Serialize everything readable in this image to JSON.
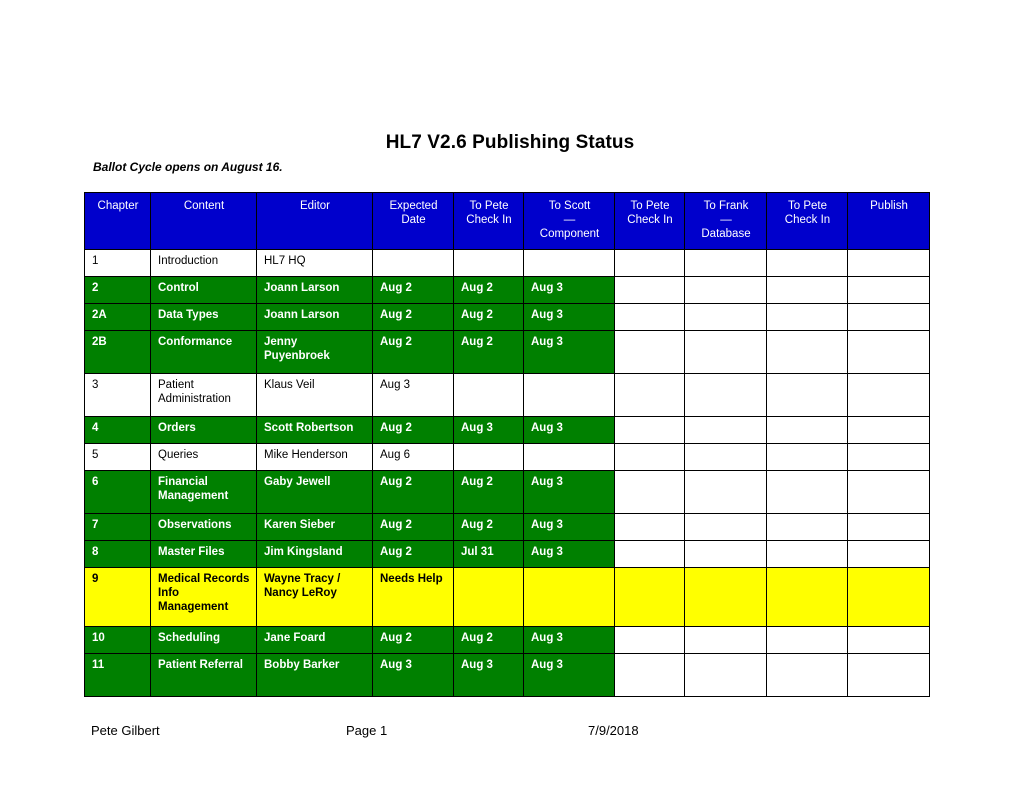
{
  "document": {
    "title": "HL7 V2.6 Publishing Status",
    "subtitle": "Ballot Cycle opens on August 16."
  },
  "colors": {
    "header_background": "#0000CC",
    "header_text": "#FFFFFF",
    "status_green": "#008000",
    "status_yellow": "#FFFF00",
    "status_white": "#FFFFFF",
    "border": "#000000"
  },
  "table": {
    "columns": [
      {
        "key": "chapter",
        "label": "Chapter"
      },
      {
        "key": "content",
        "label": "Content"
      },
      {
        "key": "editor",
        "label": "Editor"
      },
      {
        "key": "expected",
        "label": "Expected Date",
        "line1": "Expected",
        "line2": "Date"
      },
      {
        "key": "topete1",
        "label": "To Pete Check In",
        "line1": "To Pete",
        "line2": "Check In"
      },
      {
        "key": "toscott",
        "label": "To Scott — Component",
        "line1": "To Scott",
        "line2": "—",
        "line3": "Component"
      },
      {
        "key": "topete2",
        "label": "To Pete Check In",
        "line1": "To Pete",
        "line2": "Check In"
      },
      {
        "key": "tofrank",
        "label": "To Frank — Database",
        "line1": "To Frank",
        "line2": "—",
        "line3": "Database"
      },
      {
        "key": "topete3",
        "label": "To Pete Check In",
        "line1": "To Pete",
        "line2": "Check In"
      },
      {
        "key": "publish",
        "label": "Publish"
      }
    ],
    "rows": [
      {
        "state": "white",
        "height": "r-h1",
        "chapter": "1",
        "content": "Introduction",
        "editor": "HL7 HQ",
        "expected": "",
        "topete1": "",
        "toscott": "",
        "topete2": "",
        "tofrank": "",
        "topete3": "",
        "publish": ""
      },
      {
        "state": "green",
        "height": "r-h1",
        "chapter": "2",
        "content": "Control",
        "editor": "Joann Larson",
        "expected": "Aug 2",
        "topete1": "Aug 2",
        "toscott": "Aug 3",
        "topete2": "",
        "tofrank": "",
        "topete3": "",
        "publish": ""
      },
      {
        "state": "green",
        "height": "r-h1",
        "chapter": "2A",
        "content": "Data Types",
        "editor": "Joann Larson",
        "expected": "Aug 2",
        "topete1": "Aug 2",
        "toscott": "Aug 3",
        "topete2": "",
        "tofrank": "",
        "topete3": "",
        "publish": ""
      },
      {
        "state": "green",
        "height": "r-h2",
        "chapter": "2B",
        "content": "Conformance",
        "editor": "Jenny Puyenbroek",
        "expected": "Aug 2",
        "topete1": "Aug 2",
        "toscott": "Aug 3",
        "topete2": "",
        "tofrank": "",
        "topete3": "",
        "publish": ""
      },
      {
        "state": "white",
        "height": "r-h2",
        "chapter": "3",
        "content": "Patient Administration",
        "editor": "Klaus Veil",
        "expected": "Aug 3",
        "topete1": "",
        "toscott": "",
        "topete2": "",
        "tofrank": "",
        "topete3": "",
        "publish": ""
      },
      {
        "state": "green",
        "height": "r-h1",
        "chapter": "4",
        "content": "Orders",
        "editor": "Scott Robertson",
        "expected": "Aug 2",
        "topete1": "Aug 3",
        "toscott": "Aug 3",
        "topete2": "",
        "tofrank": "",
        "topete3": "",
        "publish": ""
      },
      {
        "state": "white",
        "height": "r-h1",
        "chapter": "5",
        "content": "Queries",
        "editor": "Mike Henderson",
        "expected": "Aug 6",
        "topete1": "",
        "toscott": "",
        "topete2": "",
        "tofrank": "",
        "topete3": "",
        "publish": ""
      },
      {
        "state": "green",
        "height": "r-h2",
        "chapter": "6",
        "content": "Financial Management",
        "editor": "Gaby Jewell",
        "expected": "Aug 2",
        "topete1": "Aug 2",
        "toscott": "Aug 3",
        "topete2": "",
        "tofrank": "",
        "topete3": "",
        "publish": ""
      },
      {
        "state": "green",
        "height": "r-h1",
        "chapter": "7",
        "content": "Observations",
        "editor": "Karen Sieber",
        "expected": "Aug 2",
        "topete1": "Aug 2",
        "toscott": "Aug 3",
        "topete2": "",
        "tofrank": "",
        "topete3": "",
        "publish": ""
      },
      {
        "state": "green",
        "height": "r-h1",
        "chapter": "8",
        "content": "Master Files",
        "editor": "Jim Kingsland",
        "expected": "Aug 2",
        "topete1": "Jul 31",
        "toscott": "Aug 3",
        "topete2": "",
        "tofrank": "",
        "topete3": "",
        "publish": ""
      },
      {
        "state": "yellow",
        "height": "r-h3",
        "chapter": "9",
        "content": "Medical Records Info Management",
        "editor": "Wayne Tracy / Nancy LeRoy",
        "expected": "Needs Help",
        "topete1": "",
        "toscott": "",
        "topete2": "",
        "tofrank": "",
        "topete3": "",
        "publish": ""
      },
      {
        "state": "green",
        "height": "r-h1",
        "chapter": "10",
        "content": "Scheduling",
        "editor": "Jane Foard",
        "expected": "Aug 2",
        "topete1": "Aug 2",
        "toscott": "Aug 3",
        "topete2": "",
        "tofrank": "",
        "topete3": "",
        "publish": ""
      },
      {
        "state": "green",
        "height": "r-h2",
        "chapter": "11",
        "content": "Patient Referral",
        "editor": "Bobby Barker",
        "expected": "Aug 3",
        "topete1": "Aug 3",
        "toscott": "Aug 3",
        "topete2": "",
        "tofrank": "",
        "topete3": "",
        "publish": ""
      }
    ]
  },
  "footer": {
    "author": "Pete Gilbert",
    "page": "Page 1",
    "date": "7/9/2018"
  }
}
